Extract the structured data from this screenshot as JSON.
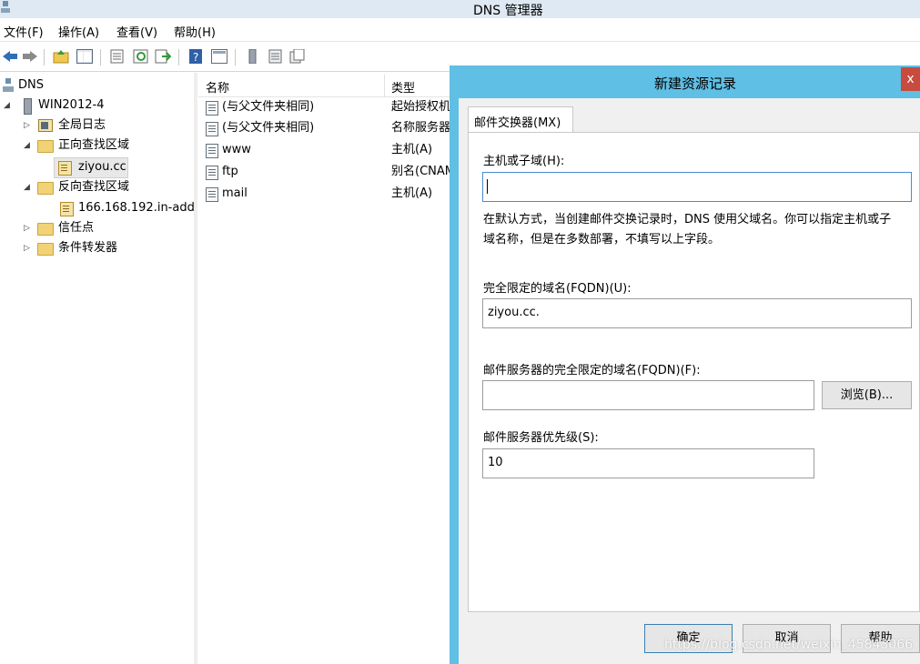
{
  "window": {
    "title": "DNS 管理器"
  },
  "menu": [
    "文件(F)",
    "操作(A)",
    "查看(V)",
    "帮助(H)"
  ],
  "toolbar_icons": [
    "back-arrow-icon",
    "forward-arrow-icon",
    "up-folder-icon",
    "show-hide-tree-icon",
    "properties-icon",
    "refresh-icon",
    "export-list-icon",
    "help-icon",
    "console-view-icon",
    "server-icon",
    "list-icon",
    "record-icon"
  ],
  "tree": {
    "root": "DNS",
    "server": "WIN2012-4",
    "items": [
      {
        "label": "全局日志"
      },
      {
        "label": "正向查找区域"
      },
      {
        "label": "ziyou.cc"
      },
      {
        "label": "反向查找区域"
      },
      {
        "label": "166.168.192.in-add"
      },
      {
        "label": "信任点"
      },
      {
        "label": "条件转发器"
      }
    ]
  },
  "list": {
    "columns": [
      "名称",
      "类型"
    ],
    "rows": [
      {
        "name": "(与父文件夹相同)",
        "type": "起始授权机"
      },
      {
        "name": "(与父文件夹相同)",
        "type": "名称服务器"
      },
      {
        "name": "www",
        "type": "主机(A)"
      },
      {
        "name": "ftp",
        "type": "别名(CNAM"
      },
      {
        "name": "mail",
        "type": "主机(A)"
      }
    ]
  },
  "dialog": {
    "title": "新建资源记录",
    "close_label": "x",
    "tab": "邮件交换器(MX)",
    "host_label": "主机或子域(H):",
    "host_value": "",
    "description_line1": "在默认方式，当创建邮件交换记录时，DNS 使用父域名。你可以指定主机或子",
    "description_line2": "域名称，但是在多数部署，不填写以上字段。",
    "fqdn_label": "完全限定的域名(FQDN)(U):",
    "fqdn_value": "ziyou.cc.",
    "mailserver_label": "邮件服务器的完全限定的域名(FQDN)(F):",
    "mailserver_value": "",
    "browse_button": "浏览(B)...",
    "priority_label": "邮件服务器优先级(S):",
    "priority_value": "10",
    "ok_button": "确定",
    "cancel_button": "取消",
    "help_button": "帮助"
  },
  "watermark": "https://blog.csdn.net/weixin_45843066",
  "colors": {
    "dialog_frame": "#5fbfe5",
    "titlebar": "#dfe9f3",
    "close": "#c74b3e"
  }
}
